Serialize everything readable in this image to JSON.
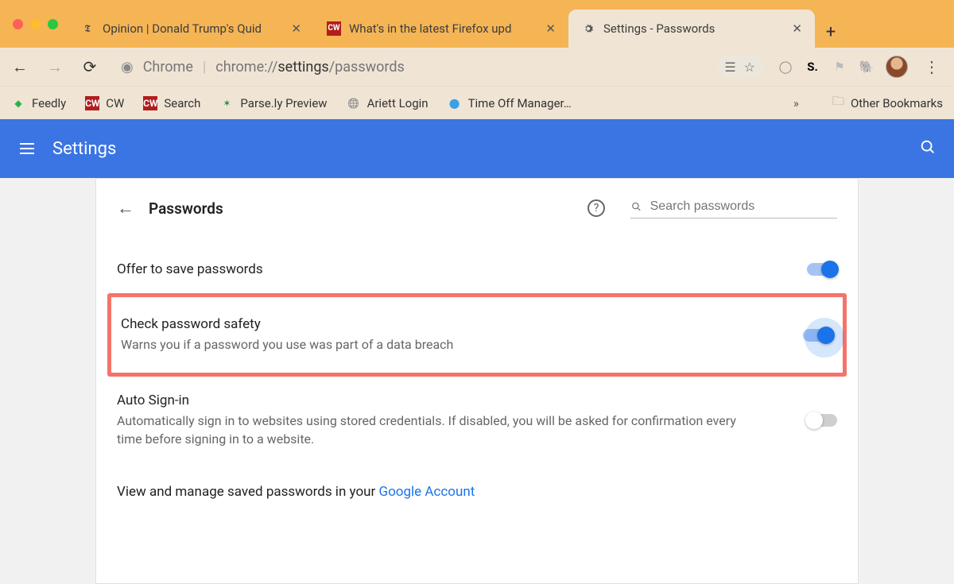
{
  "tabs": [
    {
      "title": "Opinion | Donald Trump's Quid",
      "favicon": "nyt"
    },
    {
      "title": "What's in the latest Firefox upd",
      "favicon": "cw"
    },
    {
      "title": "Settings - Passwords",
      "favicon": "gear",
      "active": true
    }
  ],
  "url": {
    "scheme": "Chrome",
    "prefix": "chrome://",
    "strong": "settings",
    "suffix": "/passwords"
  },
  "bookmarks": [
    {
      "label": "Feedly",
      "icon": "feedly"
    },
    {
      "label": "CW",
      "icon": "cw"
    },
    {
      "label": "Search",
      "icon": "cw"
    },
    {
      "label": "Parse.ly Preview",
      "icon": "parsely"
    },
    {
      "label": "Ariett Login",
      "icon": "globe"
    },
    {
      "label": "Time Off Manager…",
      "icon": "drop"
    }
  ],
  "bookmarks_overflow": "»",
  "other_bookmarks": "Other Bookmarks",
  "header": {
    "title": "Settings"
  },
  "page": {
    "title": "Passwords",
    "search_placeholder": "Search passwords"
  },
  "settings": {
    "offer_save": {
      "title": "Offer to save passwords",
      "on": true
    },
    "check_safety": {
      "title": "Check password safety",
      "desc": "Warns you if a password you use was part of a data breach",
      "on": true
    },
    "auto_signin": {
      "title": "Auto Sign-in",
      "desc": "Automatically sign in to websites using stored credentials. If disabled, you will be asked for confirmation every time before signing in to a website.",
      "on": false
    }
  },
  "footer": {
    "text": "View and manage saved passwords in your ",
    "link": "Google Account"
  }
}
